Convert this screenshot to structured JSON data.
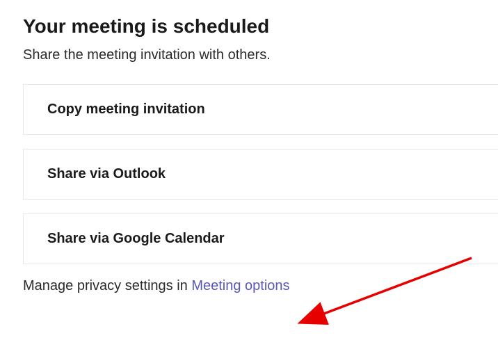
{
  "header": {
    "title": "Your meeting is scheduled",
    "subtitle": "Share the meeting invitation with others."
  },
  "options": {
    "copy_invitation": "Copy meeting invitation",
    "share_outlook": "Share via Outlook",
    "share_google": "Share via Google Calendar"
  },
  "footer": {
    "prefix": "Manage privacy settings in ",
    "link": "Meeting options"
  }
}
